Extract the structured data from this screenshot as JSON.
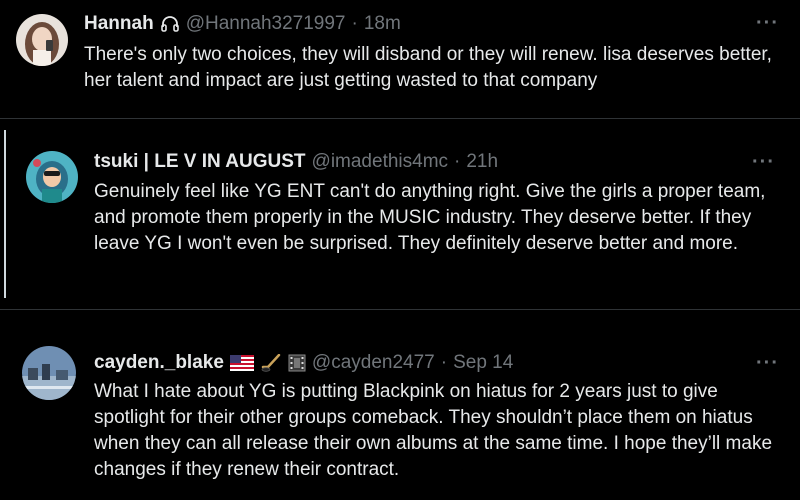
{
  "tweets": [
    {
      "name": "Hannah",
      "name_icon": "headphones-icon",
      "handle": "@Hannah3271997",
      "dot": "·",
      "time": "18m",
      "more": "···",
      "text": "There's only two choices, they will disband or they will renew. lisa deserves better, her talent and impact are just getting wasted to that company"
    },
    {
      "name": "tsuki | LE V IN AUGUST",
      "handle": "@imadethis4mc",
      "dot": "·",
      "time": "21h",
      "more": "···",
      "text": "Genuinely feel like YG ENT can't do anything right. Give the girls a proper team, and promote them properly in the MUSIC industry. They deserve better. If they leave YG I won't even be surprised. They definitely deserve better and more."
    },
    {
      "name": "cayden._blake",
      "name_icons": [
        "us-flag-icon",
        "hockey-stick-icon",
        "film-icon"
      ],
      "handle": "@cayden2477",
      "dot": "·",
      "time": "Sep 14",
      "more": "···",
      "text": "What I hate about YG is putting Blackpink on hiatus for 2 years just to give spotlight for their other groups comeback.  They shouldn’t place them on hiatus when they can all release their own albums at the same time.  I hope they’ll make changes if they renew their contract."
    }
  ],
  "colors": {
    "background": "#000000",
    "text_primary": "#e7e9ea",
    "text_secondary": "#71767b",
    "divider": "#2f3336"
  }
}
